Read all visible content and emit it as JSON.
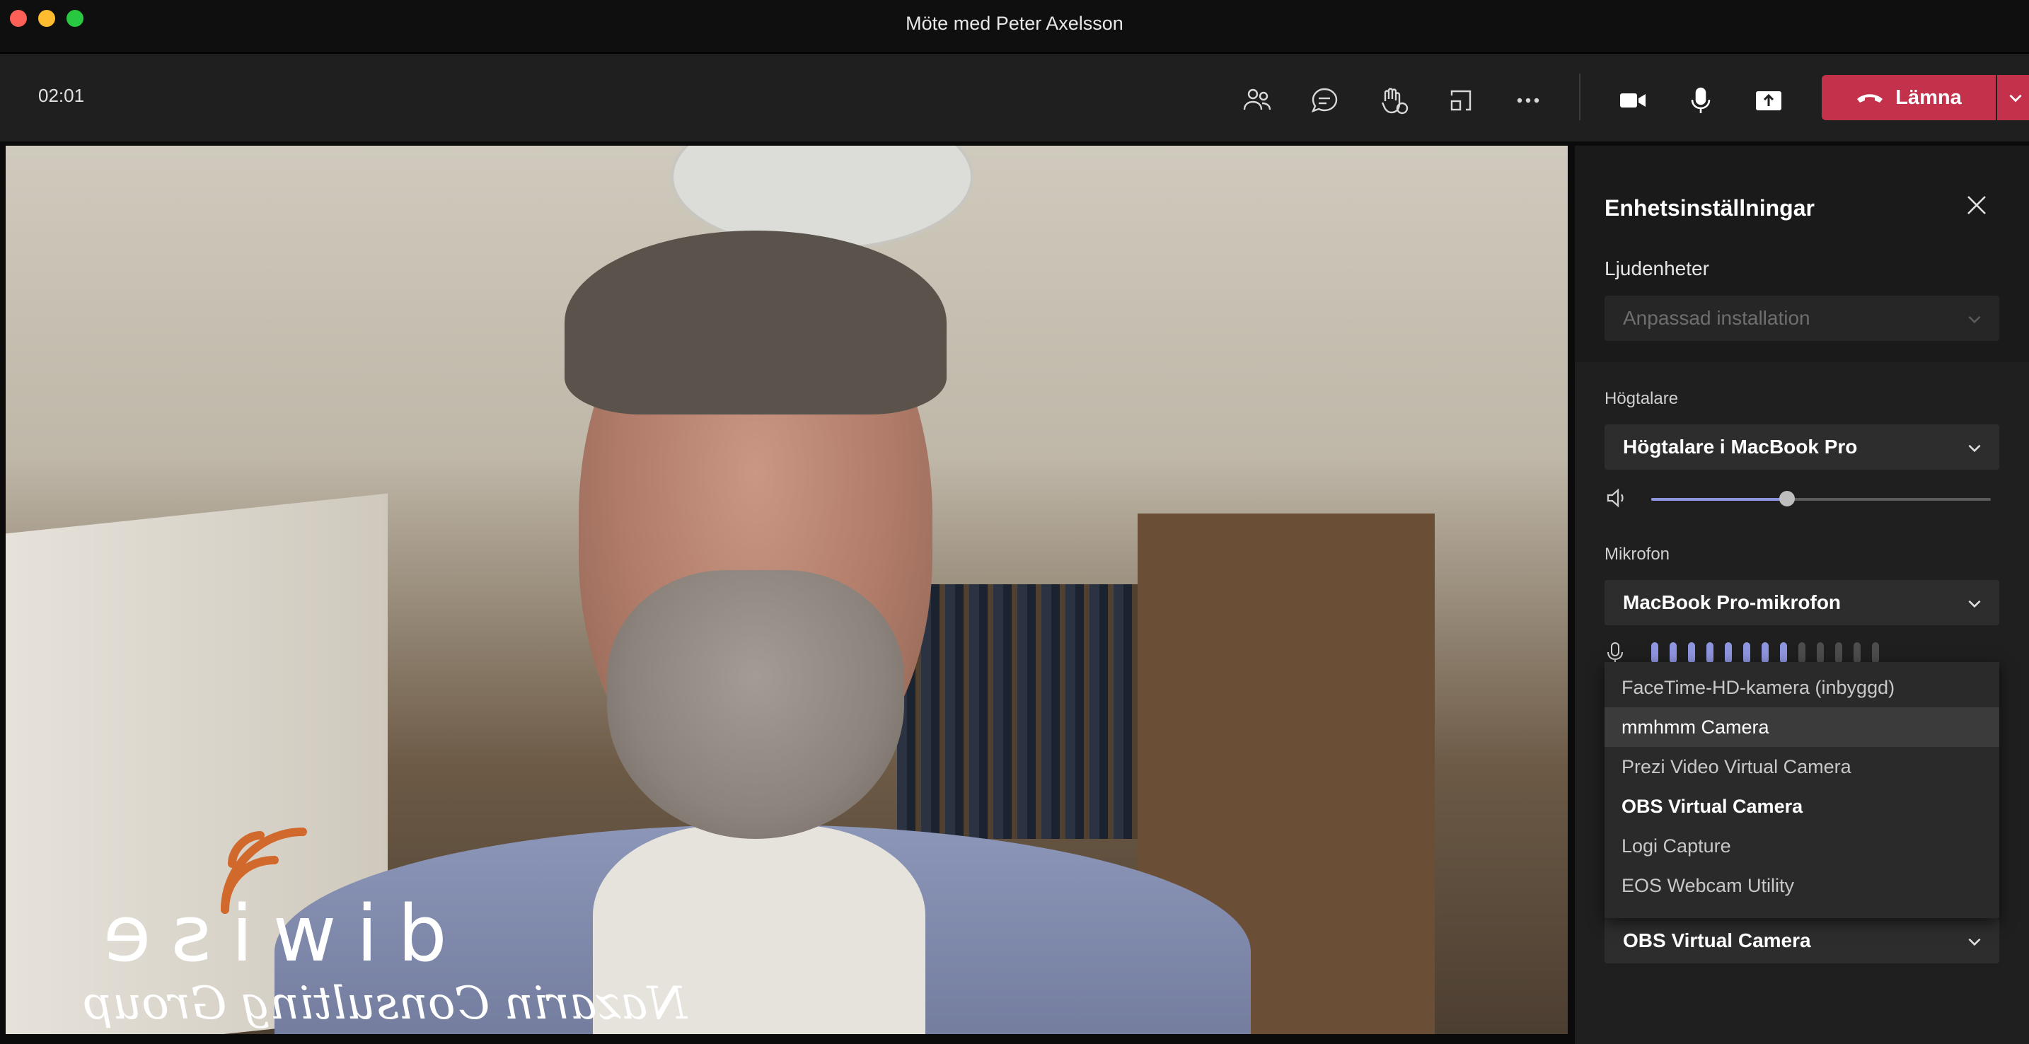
{
  "window": {
    "title": "Möte med Peter Axelsson"
  },
  "toolbar": {
    "timer": "02:01",
    "leave_label": "Lämna"
  },
  "video": {
    "logo_text": "diwise",
    "logo_tagline": "Nazarin Consulting Group"
  },
  "panel": {
    "title": "Enhetsinställningar",
    "audio_devices_label": "Ljudenheter",
    "audio_devices_value": "Anpassad installation",
    "speaker_label": "Högtalare",
    "speaker_value": "Högtalare i MacBook Pro",
    "speaker_volume": 0.4,
    "mic_label": "Mikrofon",
    "mic_value": "MacBook Pro-mikrofon",
    "mic_level_bars_on": 8,
    "mic_level_bars_total": 13,
    "camera_value": "OBS Virtual Camera"
  },
  "camera_dropdown": {
    "items": [
      "FaceTime-HD-kamera (inbyggd)",
      "mmhmm Camera",
      "Prezi Video Virtual Camera",
      "OBS Virtual Camera",
      "Logi Capture",
      "EOS Webcam Utility"
    ],
    "hover_index": 1,
    "selected_index": 3
  },
  "colors": {
    "accent": "#8f96e0",
    "leave": "#c4314b",
    "panel_bg": "#1f1f1f"
  }
}
